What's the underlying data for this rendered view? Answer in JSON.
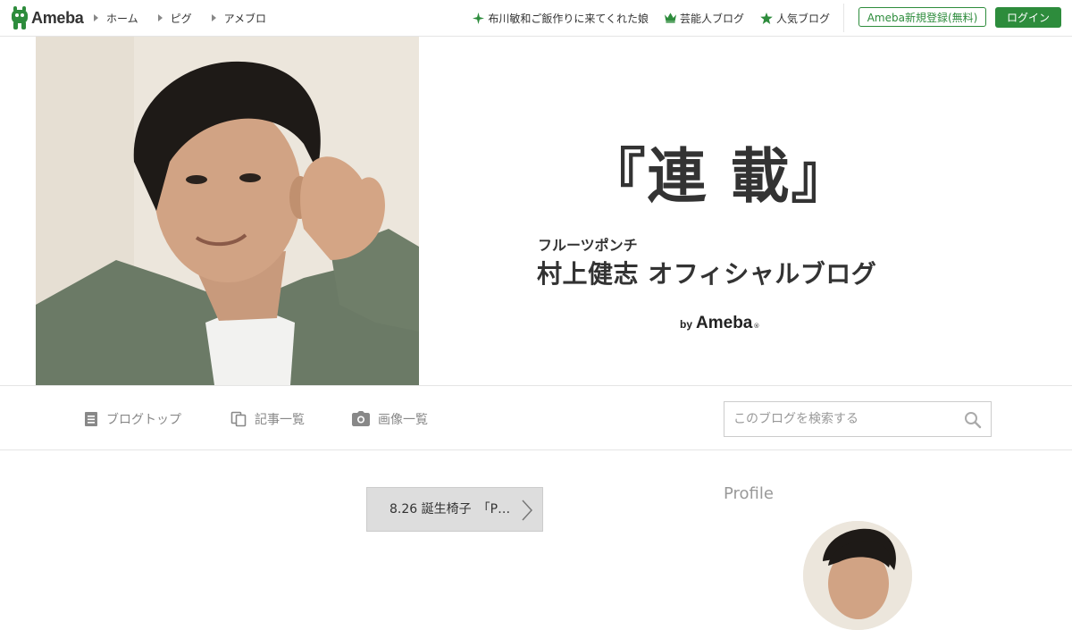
{
  "global_header": {
    "logo_text": "Ameba",
    "nav_left": [
      {
        "label": "ホーム"
      },
      {
        "label": "ピグ"
      },
      {
        "label": "アメブロ"
      }
    ],
    "nav_right": [
      {
        "label": "布川敏和ご飯作りに来てくれた娘",
        "icon": "sparkle-icon"
      },
      {
        "label": "芸能人ブログ",
        "icon": "crown-icon"
      },
      {
        "label": "人気ブログ",
        "icon": "star-icon"
      }
    ],
    "register_label": "Ameba新規登録(無料)",
    "login_label": "ログイン"
  },
  "banner": {
    "title": "『連 載』",
    "subtitle": "フルーツポンチ",
    "blog_name": "村上健志 オフィシャルブログ",
    "by_label": "by",
    "by_brand": "Ameba",
    "by_reg": "®"
  },
  "blog_menu": {
    "items": [
      {
        "label": "ブログトップ",
        "icon": "document-icon"
      },
      {
        "label": "記事一覧",
        "icon": "copy-icon"
      },
      {
        "label": "画像一覧",
        "icon": "camera-icon"
      }
    ],
    "search_placeholder": "このブログを検索する",
    "search_value": ""
  },
  "content": {
    "next_entry_label": "8.26 誕生椅子　「P…",
    "profile_heading": "Profile"
  },
  "colors": {
    "accent": "#2d8c3c",
    "text": "#333333",
    "muted": "#888888",
    "border": "#e5e5e5"
  }
}
